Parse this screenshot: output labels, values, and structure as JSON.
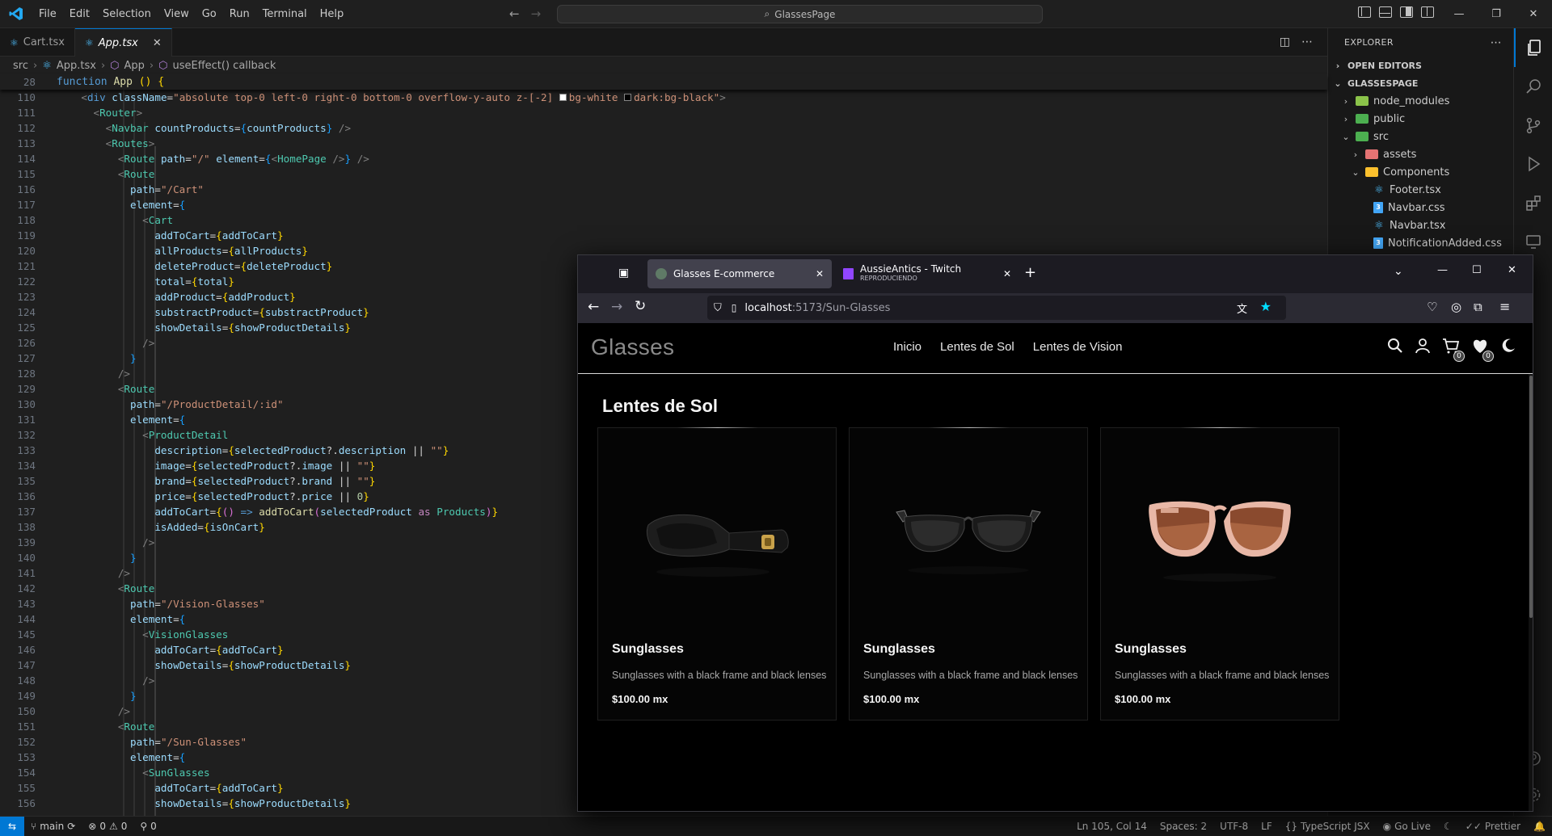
{
  "titlebar": {
    "menu": [
      "File",
      "Edit",
      "Selection",
      "View",
      "Go",
      "Run",
      "Terminal",
      "Help"
    ],
    "command_center": "GlassesPage",
    "accent": "#0078d4"
  },
  "tabs": [
    {
      "label": "Cart.tsx",
      "active": false
    },
    {
      "label": "App.tsx",
      "active": true
    }
  ],
  "breadcrumb": [
    "src",
    "App.tsx",
    "App",
    "useEffect() callback"
  ],
  "sticky": {
    "ln": "28",
    "text": "function App () {"
  },
  "editor": {
    "lines": [
      {
        "ln": "110"
      },
      {
        "ln": "111"
      },
      {
        "ln": "112"
      },
      {
        "ln": "113"
      },
      {
        "ln": "114"
      },
      {
        "ln": "115"
      },
      {
        "ln": "116"
      },
      {
        "ln": "117"
      },
      {
        "ln": "118"
      },
      {
        "ln": "119"
      },
      {
        "ln": "120"
      },
      {
        "ln": "121"
      },
      {
        "ln": "122"
      },
      {
        "ln": "123"
      },
      {
        "ln": "124"
      },
      {
        "ln": "125"
      },
      {
        "ln": "126"
      },
      {
        "ln": "127"
      },
      {
        "ln": "128"
      },
      {
        "ln": "129"
      },
      {
        "ln": "130"
      },
      {
        "ln": "131"
      },
      {
        "ln": "132"
      },
      {
        "ln": "133"
      },
      {
        "ln": "134"
      },
      {
        "ln": "135"
      },
      {
        "ln": "136"
      },
      {
        "ln": "137"
      },
      {
        "ln": "138"
      },
      {
        "ln": "139"
      },
      {
        "ln": "140"
      },
      {
        "ln": "141"
      },
      {
        "ln": "142"
      },
      {
        "ln": "143"
      },
      {
        "ln": "144"
      },
      {
        "ln": "145"
      },
      {
        "ln": "146"
      },
      {
        "ln": "147"
      },
      {
        "ln": "148"
      },
      {
        "ln": "149"
      },
      {
        "ln": "150"
      },
      {
        "ln": "151"
      },
      {
        "ln": "152"
      },
      {
        "ln": "153"
      },
      {
        "ln": "154"
      },
      {
        "ln": "155"
      },
      {
        "ln": "156"
      }
    ],
    "code": {
      "l110_class": "\"absolute top-0 left-0 right-0 bottom-0 overflow-y-auto z-[-2] ",
      "l110_bg1": "bg-white",
      "l110_bg2": "dark:bg-black\"",
      "path_cart": "\"/Cart\"",
      "path_detail": "\"/ProductDetail/:id\"",
      "path_vision": "\"/Vision-Glasses\"",
      "path_sun": "\"/Sun-Glasses\"",
      "path_home": "\"/\""
    }
  },
  "explorer": {
    "title": "EXPLORER",
    "open_editors": "OPEN EDITORS",
    "project": "GLASSESPAGE",
    "items": [
      {
        "label": "node_modules"
      },
      {
        "label": "public"
      },
      {
        "label": "src"
      },
      {
        "label": "assets"
      },
      {
        "label": "Components"
      },
      {
        "label": "Footer.tsx"
      },
      {
        "label": "Navbar.css"
      },
      {
        "label": "Navbar.tsx"
      },
      {
        "label": "NotificationAdded.css"
      }
    ]
  },
  "statusbar": {
    "branch": "main",
    "errors": "0",
    "warnings": "0",
    "ports": "0",
    "position": "Ln 105, Col 14",
    "spaces": "Spaces: 2",
    "encoding": "UTF-8",
    "eol": "LF",
    "language": "TypeScript JSX",
    "golive": "Go Live",
    "prettier": "Prettier"
  },
  "browser": {
    "tabs": [
      {
        "label": "Glasses E-commerce",
        "sub": ""
      },
      {
        "label": "AussieAntics - Twitch",
        "sub": "REPRODUCIENDO"
      }
    ],
    "url_host": "localhost",
    "url_path": ":5173/Sun-Glasses"
  },
  "site": {
    "logo": "Glasses",
    "nav": [
      "Inicio",
      "Lentes de Sol",
      "Lentes de Vision"
    ],
    "cart_count": "0",
    "fav_count": "0",
    "section_title": "Lentes de Sol",
    "products": [
      {
        "name": "Sunglasses",
        "description": "Sunglasses with a black frame and black lenses",
        "price": "$100.00 mx",
        "frame_color": "black-gold"
      },
      {
        "name": "Sunglasses",
        "description": "Sunglasses with a black frame and black lenses",
        "price": "$100.00 mx",
        "frame_color": "black"
      },
      {
        "name": "Sunglasses",
        "description": "Sunglasses with a black frame and black lenses",
        "price": "$100.00 mx",
        "frame_color": "pink"
      }
    ]
  }
}
